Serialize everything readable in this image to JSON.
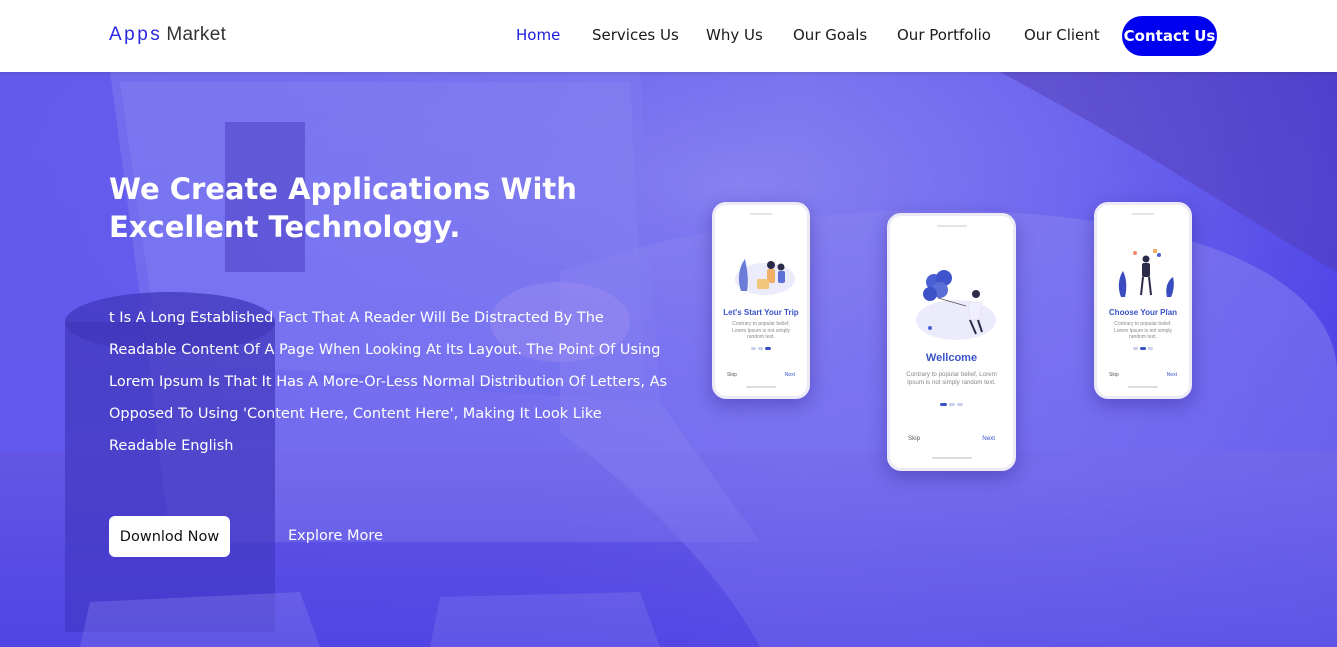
{
  "brand": {
    "part1": "Apps",
    "part2": "Market"
  },
  "nav": {
    "items": [
      "Home",
      "Services Us",
      "Why Us",
      "Our Goals",
      "Our Portfolio",
      "Our Client"
    ],
    "active": "Home",
    "contact": "Contact Us"
  },
  "hero": {
    "title": "We Create Applications With Excellent Technology.",
    "text": "t Is A Long Established Fact That A Reader Will Be Distracted By The Readable Content Of A Page When Looking At Its Layout. The Point Of Using Lorem Ipsum Is That It Has A More-Or-Less Normal Distribution Of Letters, As Opposed To Using 'Content Here, Content Here', Making It Look Like Readable English",
    "download_label": "Downlod Now",
    "explore_label": "Explore More"
  },
  "phones": [
    {
      "title": "Let's Start Your Trip",
      "desc": "Contrary to popular belief, Lorem Ipsum is not simply random text.",
      "skip": "Skip",
      "next": "Next"
    },
    {
      "title": "Wellcome",
      "desc": "Contrary to popular belief, Lorem Ipsum is not simply random text.",
      "skip": "Skip",
      "next": "Next"
    },
    {
      "title": "Choose Your Plan",
      "desc": "Contrary to popular belief, Lorem Ipsum is not simply random text.",
      "skip": "Skip",
      "next": "Next"
    }
  ],
  "colors": {
    "accent": "#0000f0",
    "nav_active": "#1b1bdc",
    "brand_blue": "#2a2ae0",
    "hero_tint": "#5b4fe6"
  }
}
